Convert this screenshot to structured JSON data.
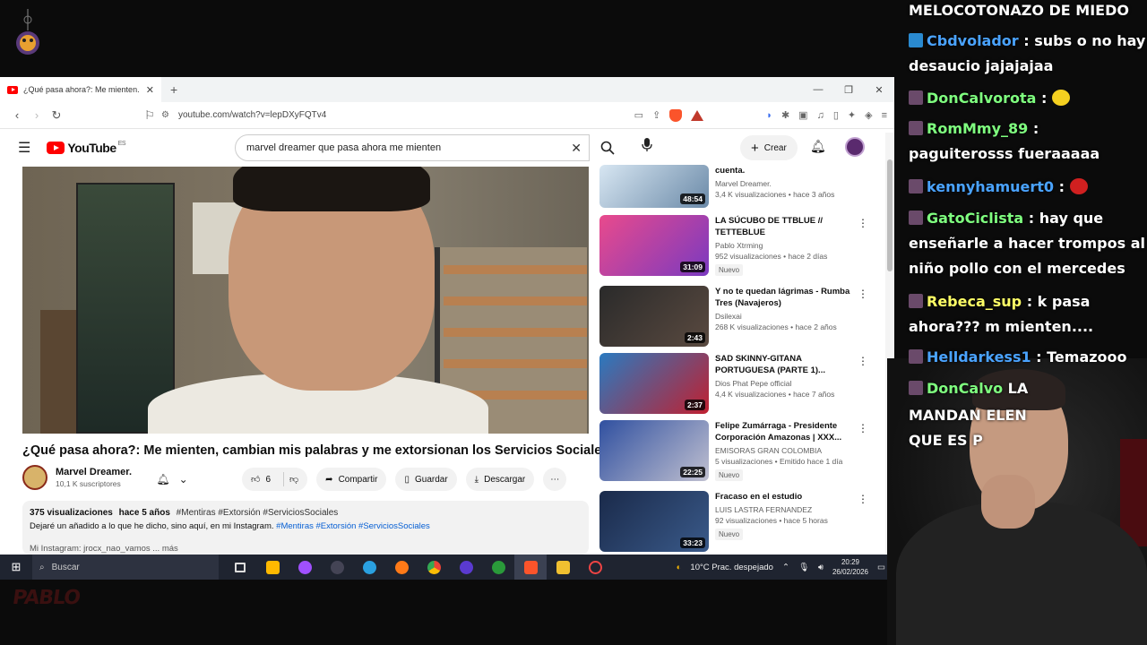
{
  "browser": {
    "tab_title": "¿Qué pasa ahora?: Me mienten.",
    "url": "youtube.com/watch?v=lepDXyFQTv4"
  },
  "youtube": {
    "logo": "YouTube",
    "region": "ES",
    "search_query": "marvel dreamer que pasa ahora me mienten",
    "create_label": "Crear"
  },
  "video": {
    "title": "¿Qué pasa ahora?: Me mienten, cambian mis palabras y me extorsionan los Servicios Sociales.",
    "channel": "Marvel Dreamer.",
    "subscribers": "10,1 K suscriptores",
    "likes": "6",
    "share_label": "Compartir",
    "save_label": "Guardar",
    "download_label": "Descargar",
    "views": "375 visualizaciones",
    "age": "hace 5 años",
    "hashtags": "#Mentiras #Extorsión #ServiciosSociales",
    "description_text": "Dejaré un añadido a lo que he dicho, sino aquí, en mi Instagram.",
    "description_links": "#Mentiras #Extorsión #ServiciosSociales",
    "description_more": "Mi Instagram: jrocx_nao_vamos ... más"
  },
  "related": [
    {
      "title": "cuenta.",
      "channel": "Marvel Dreamer.",
      "meta": "3,4 K visualizaciones • hace 3 años",
      "duration": "48:54",
      "badge": ""
    },
    {
      "title": "LA SÚCUBO DE TTBLUE  // TETTEBLUE",
      "channel": "Pablo Xtrming",
      "meta": "952 visualizaciones • hace 2 días",
      "duration": "31:09",
      "badge": "Nuevo"
    },
    {
      "title": "Y no te quedan lágrimas - Rumba Tres (Navajeros)",
      "channel": "Dsilexai",
      "meta": "268 K visualizaciones • hace 2 años",
      "duration": "2:43",
      "badge": ""
    },
    {
      "title": "SAD SKINNY-GITANA PORTUGUESA (PARTE 1)...",
      "channel": "Dios Phat Pepe official",
      "meta": "4,4 K visualizaciones • hace 7 años",
      "duration": "2:37",
      "badge": ""
    },
    {
      "title": "Felipe Zumárraga - Presidente Corporación Amazonas | XXX...",
      "channel": "EMISORAS GRAN COLOMBIA",
      "meta": "5 visualizaciones • Emitido hace 1 día",
      "duration": "22:25",
      "badge": "Nuevo"
    },
    {
      "title": "Fracaso en el estudio",
      "channel": "LUIS LASTRA FERNANDEZ",
      "meta": "92 visualizaciones • hace 5 horas",
      "duration": "33:23",
      "badge": "Nuevo"
    }
  ],
  "taskbar": {
    "search_placeholder": "Buscar",
    "weather": "10°C  Prac. despejado",
    "time": "20:29",
    "date": "26/02/2026"
  },
  "chat": [
    {
      "user": "",
      "text": "MELOCOTONAZO DE MIEDO",
      "color": "#ffffff"
    },
    {
      "user": "Cbdvolador",
      "text": " : subs o no hay desaucio jajajajaa",
      "color": "#4aa3ff"
    },
    {
      "user": "DonCalvorota",
      "text": " : ",
      "color": "#7fff7f"
    },
    {
      "user": "RomMmy_89",
      "text": " : paguiterosss fueraaaaa",
      "color": "#7fff7f"
    },
    {
      "user": "kennyhamuert0",
      "text": " : ",
      "color": "#4aa3ff"
    },
    {
      "user": "GatoCiclista",
      "text": " : hay que enseñarle a hacer trompos al niño pollo con el mercedes",
      "color": "#7fff7f"
    },
    {
      "user": "Rebeca_sup",
      "text": " : k pasa ahora??? m mienten....",
      "color": "#ffff66"
    },
    {
      "user": "Helldarkess1",
      "text": " : Temazooo",
      "color": "#4aa3ff"
    },
    {
      "user": "DonCalvo",
      "text": "           LA",
      "color": "#7fff7f"
    },
    {
      "user": "",
      "text": "MANDAN            ELEN",
      "color": "#ffffff"
    },
    {
      "user": "",
      "text": "QUE ES P",
      "color": "#ffffff"
    }
  ],
  "overlay": {
    "corner_logo": "PABLO"
  }
}
